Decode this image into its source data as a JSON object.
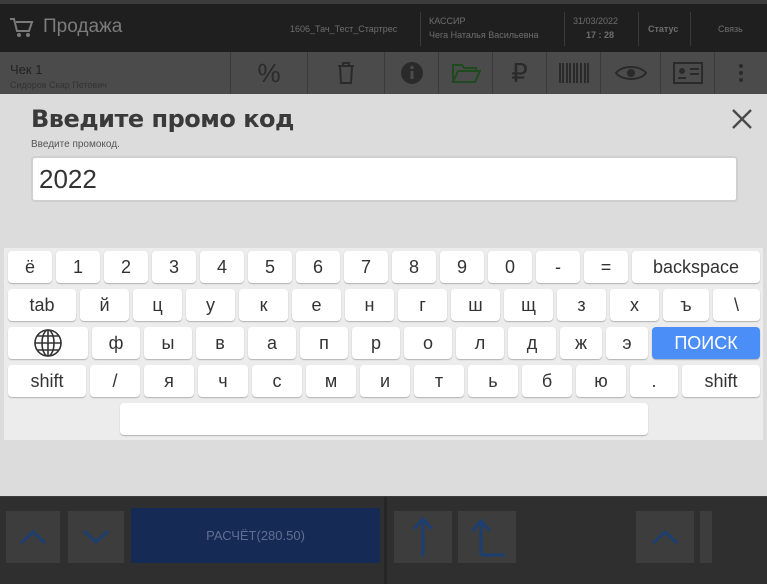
{
  "header": {
    "title": "Продажа",
    "store": "1606_Тач_Тест_Стартрес",
    "role": "КАССИР",
    "cashier_name": "Чега Наталья Васильевна",
    "date": "31/03/2022",
    "time": "17 : 28",
    "status_label": "Статус",
    "connection_label": "Связь"
  },
  "toolbar": {
    "check_label": "Чек 1",
    "customer": "Сидоров Скар Петович",
    "icons": [
      "percent-icon",
      "trash-icon",
      "info-icon",
      "folder-open-icon",
      "ruble-icon",
      "barcode-icon",
      "eye-icon",
      "id-card-icon",
      "more-vert-icon"
    ]
  },
  "dialog": {
    "title": "Введите промо код",
    "subtitle": "Введите промокод.",
    "input_value": "2022"
  },
  "keyboard": {
    "row1": [
      "ё",
      "1",
      "2",
      "3",
      "4",
      "5",
      "6",
      "7",
      "8",
      "9",
      "0",
      "-",
      "="
    ],
    "backspace": "backspace",
    "tab": "tab",
    "row2": [
      "й",
      "ц",
      "у",
      "к",
      "е",
      "н",
      "г",
      "ш",
      "щ",
      "з",
      "х",
      "ъ",
      "\\"
    ],
    "row3": [
      "ф",
      "ы",
      "в",
      "а",
      "п",
      "р",
      "о",
      "л",
      "д",
      "ж",
      "э"
    ],
    "search": "ПОИСК",
    "shift": "shift",
    "row4": [
      "/",
      "я",
      "ч",
      "с",
      "м",
      "и",
      "т",
      "ь",
      "б",
      "ю",
      "."
    ],
    "language_icon": "globe-icon"
  },
  "bottom": {
    "pay_label": "РАСЧЁТ(280.50)"
  },
  "colors": {
    "accent": "#4c8ef7",
    "dialog_bg": "#dcdcdc",
    "pay_button": "#152a55"
  }
}
